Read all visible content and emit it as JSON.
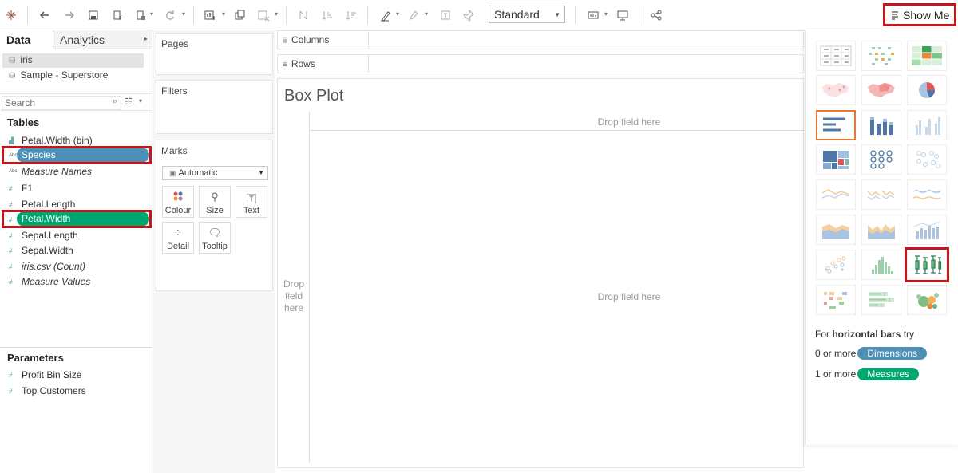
{
  "toolbar": {
    "fit_select": "Standard",
    "show_me_label": "Show Me"
  },
  "data_pane": {
    "tabs": {
      "data": "Data",
      "analytics": "Analytics"
    },
    "datasources": [
      "iris",
      "Sample - Superstore"
    ],
    "search_placeholder": "Search",
    "tables_heading": "Tables",
    "fields": [
      {
        "name": "Petal.Width (bin)",
        "type": "bin"
      },
      {
        "name": "Species",
        "type": "dimension",
        "selected": true
      },
      {
        "name": "Measure Names",
        "type": "dimension"
      },
      {
        "name": "F1",
        "type": "measure"
      },
      {
        "name": "Petal.Length",
        "type": "measure"
      },
      {
        "name": "Petal.Width",
        "type": "measure",
        "selected": true
      },
      {
        "name": "Sepal.Length",
        "type": "measure"
      },
      {
        "name": "Sepal.Width",
        "type": "measure"
      },
      {
        "name": "iris.csv (Count)",
        "type": "measure"
      },
      {
        "name": "Measure Values",
        "type": "measure"
      }
    ],
    "parameters_heading": "Parameters",
    "parameters": [
      "Profit Bin Size",
      "Top Customers"
    ]
  },
  "cards": {
    "pages": "Pages",
    "filters": "Filters",
    "marks": "Marks",
    "mark_type": "Automatic",
    "mark_buttons": [
      "Colour",
      "Size",
      "Text",
      "Detail",
      "Tooltip"
    ]
  },
  "shelves": {
    "columns": "Columns",
    "rows": "Rows"
  },
  "view": {
    "title": "Box Plot",
    "drop_top": "Drop field here",
    "drop_left": [
      "Drop",
      "field",
      "here"
    ],
    "drop_center": "Drop field here"
  },
  "show_me": {
    "hint_prefix": "For",
    "hint_bold": "horizontal bars",
    "hint_suffix": "try",
    "req1_text": "0 or more",
    "req1_pill": "Dimensions",
    "req2_text": "1 or more",
    "req2_pill": "Measures",
    "selected_chart": "horizontal-bars",
    "highlighted_chart": "box-and-whisker"
  },
  "colors": {
    "dimension_pill": "#4e8fb5",
    "measure_pill": "#00a66f",
    "highlight": "#c5161d",
    "selected_border": "#e07b39"
  }
}
